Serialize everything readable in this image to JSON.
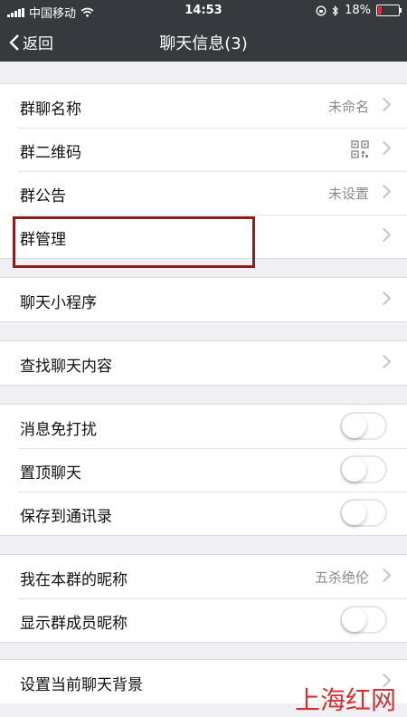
{
  "status": {
    "carrier": "中国移动",
    "time": "14:53",
    "battery": "18%"
  },
  "nav": {
    "back": "返回",
    "title": "聊天信息(3)"
  },
  "groups": [
    {
      "rows": [
        {
          "label": "群聊名称",
          "value": "未命名"
        },
        {
          "label": "群二维码",
          "icon": "qrcode-icon"
        },
        {
          "label": "群公告",
          "value": "未设置"
        },
        {
          "label": "群管理"
        }
      ]
    },
    {
      "rows": [
        {
          "label": "聊天小程序"
        }
      ]
    },
    {
      "rows": [
        {
          "label": "查找聊天内容"
        }
      ]
    },
    {
      "rows": [
        {
          "label": "消息免打扰",
          "toggle": false
        },
        {
          "label": "置顶聊天",
          "toggle": false
        },
        {
          "label": "保存到通讯录",
          "toggle": false
        }
      ]
    },
    {
      "rows": [
        {
          "label": "我在本群的昵称",
          "value": "五杀绝伦"
        },
        {
          "label": "显示群成员昵称",
          "toggle": false
        }
      ]
    },
    {
      "rows": [
        {
          "label": "设置当前聊天背景"
        }
      ]
    }
  ],
  "watermark": "上海红网",
  "colors": {
    "navbar": "#363a3f",
    "highlight_box": "#8b1e1e",
    "watermark": "#d01b1b"
  }
}
